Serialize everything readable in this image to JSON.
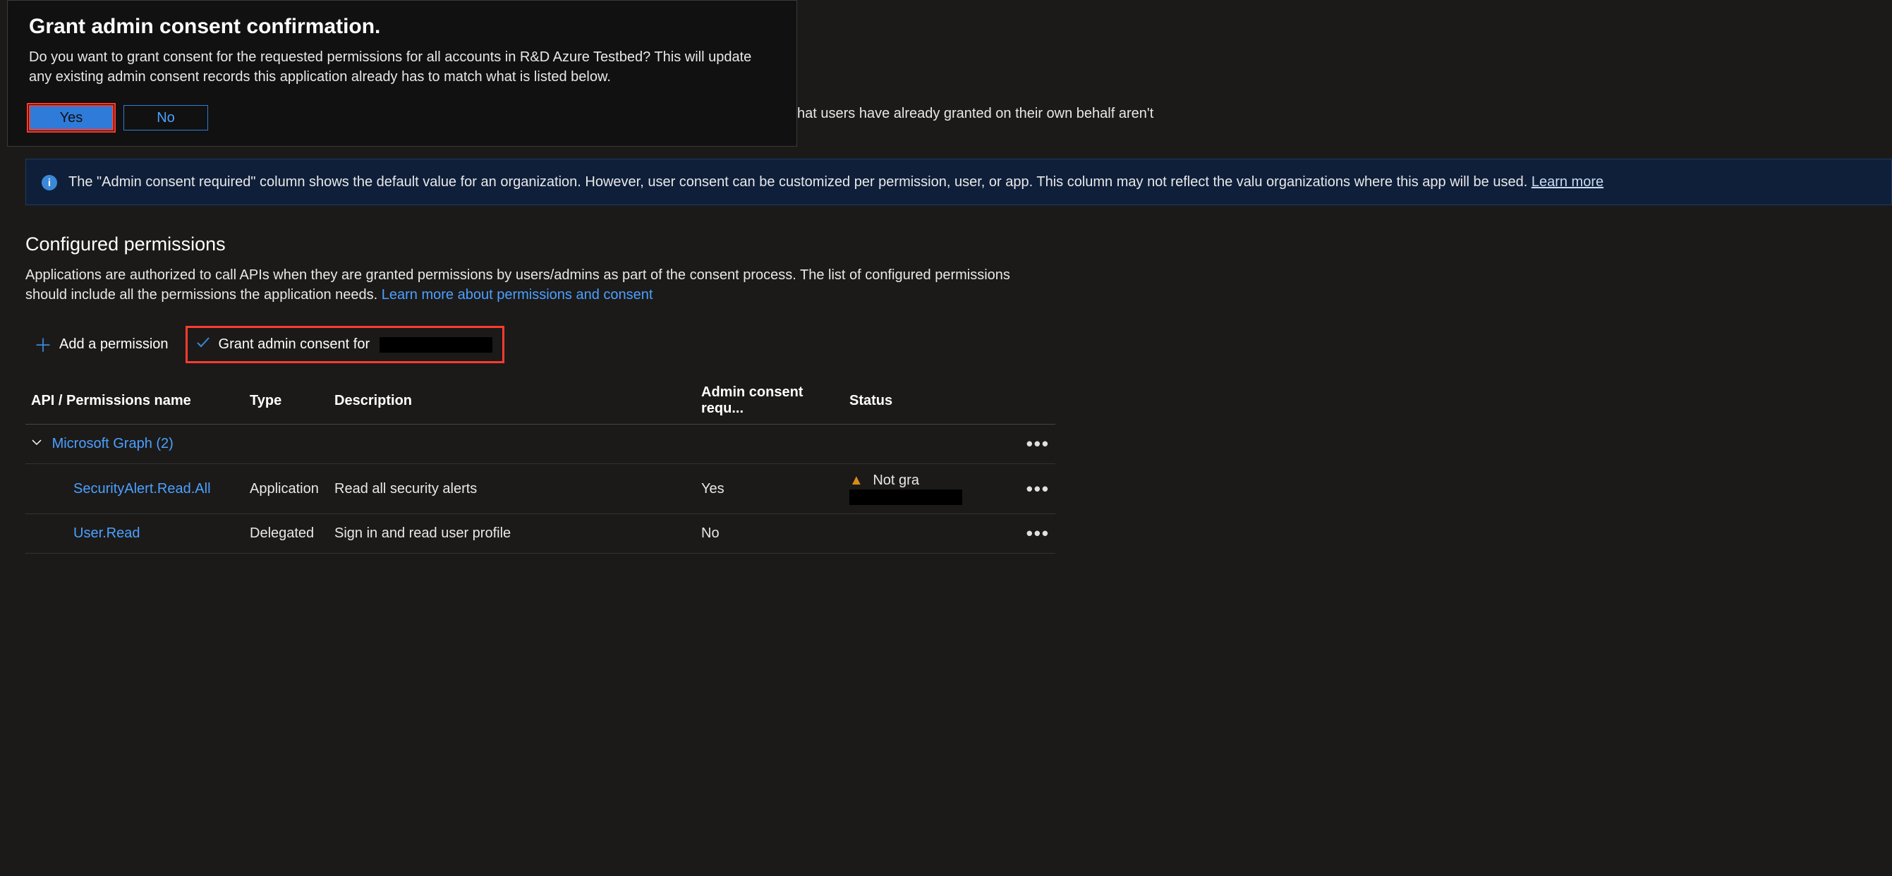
{
  "dialog": {
    "title": "Grant admin consent confirmation.",
    "body": "Do you want to grant consent for the requested permissions for all accounts in R&D Azure Testbed? This will update any existing admin consent records this application already has to match what is listed below.",
    "yes": "Yes",
    "no": "No"
  },
  "warn_banner": "hat users have already granted on their own behalf aren't",
  "info_banner": {
    "text": "The \"Admin consent required\" column shows the default value for an organization. However, user consent can be customized per permission, user, or app. This column may not reflect the valu organizations where this app will be used. ",
    "learn_more": "Learn more"
  },
  "configured": {
    "heading": "Configured permissions",
    "desc_pre": "Applications are authorized to call APIs when they are granted permissions by users/admins as part of the consent process. The list of configured permissions should include all the permissions the application needs. ",
    "desc_link": "Learn more about permissions and consent"
  },
  "toolbar": {
    "add_permission": "Add a permission",
    "grant_consent": "Grant admin consent for"
  },
  "table": {
    "headers": {
      "name": "API / Permissions name",
      "type": "Type",
      "desc": "Description",
      "admin": "Admin consent requ...",
      "status": "Status"
    },
    "group": "Microsoft Graph (2)",
    "rows": [
      {
        "name": "SecurityAlert.Read.All",
        "type": "Application",
        "desc": "Read all security alerts",
        "admin": "Yes",
        "status": "Not gra",
        "status_warn": true
      },
      {
        "name": "User.Read",
        "type": "Delegated",
        "desc": "Sign in and read user profile",
        "admin": "No",
        "status": "",
        "status_warn": false
      }
    ]
  },
  "glyphs": {
    "dots": "•••"
  }
}
